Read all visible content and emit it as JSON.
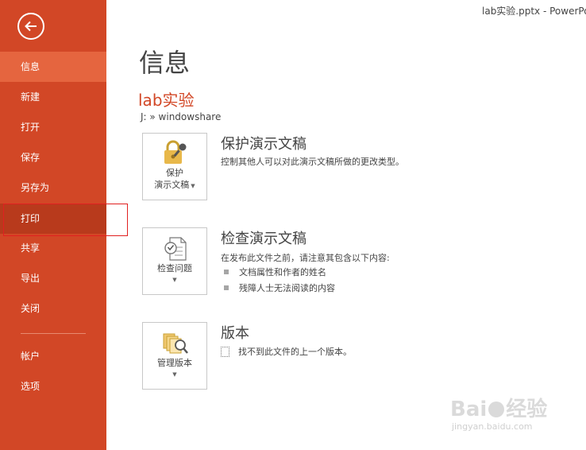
{
  "window": {
    "title": "lab实验.pptx - PowerPoint"
  },
  "sidebar": {
    "items": [
      {
        "label": "信息",
        "state": "active"
      },
      {
        "label": "新建"
      },
      {
        "label": "打开"
      },
      {
        "label": "保存"
      },
      {
        "label": "另存为"
      },
      {
        "label": "打印",
        "state": "highlighted"
      },
      {
        "label": "共享"
      },
      {
        "label": "导出"
      },
      {
        "label": "关闭"
      },
      {
        "label": "帐户"
      },
      {
        "label": "选项"
      }
    ]
  },
  "main": {
    "title": "信息",
    "doc_name": "lab实验",
    "doc_path": "J: » windowshare",
    "sections": [
      {
        "button_line1": "保护",
        "button_line2": "演示文稿",
        "title": "保护演示文稿",
        "desc": "控制其他人可以对此演示文稿所做的更改类型。"
      },
      {
        "button_line1": "检查问题",
        "title": "检查演示文稿",
        "desc": "在发布此文件之前，请注意其包含以下内容:",
        "bullets": [
          "文档属性和作者的姓名",
          "残障人士无法阅读的内容"
        ]
      },
      {
        "button_line1": "管理版本",
        "title": "版本",
        "desc": "找不到此文件的上一个版本。"
      }
    ]
  },
  "watermark": {
    "line1": "Bai",
    "line2": "经验",
    "url": "jingyan.baidu.com"
  },
  "colors": {
    "accent": "#d24726",
    "active": "#e5653f",
    "hover": "#b83a1c"
  }
}
